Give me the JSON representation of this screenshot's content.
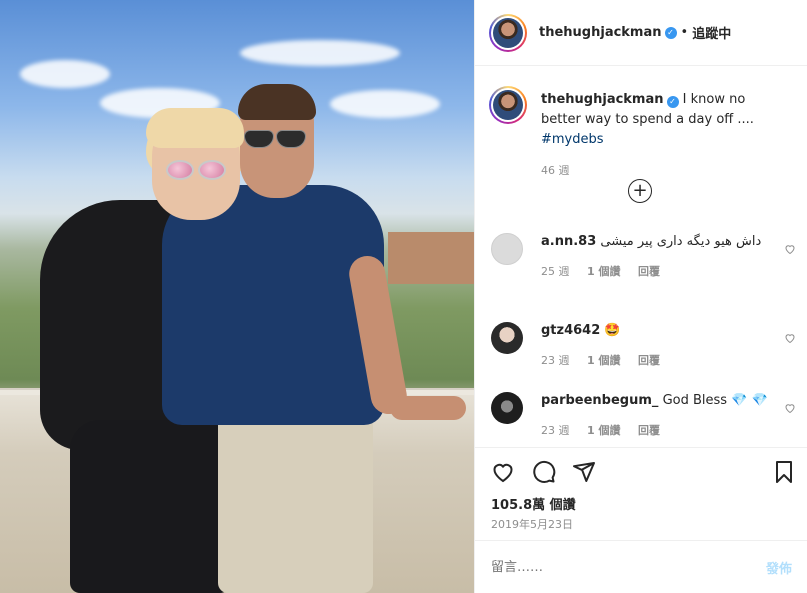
{
  "header": {
    "username": "thehughjackman",
    "verified": true,
    "separator": "•",
    "follow_label": "追蹤中"
  },
  "caption": {
    "username": "thehughjackman",
    "text": "I know no better way to spend a day off ....",
    "hashtag": "#mydebs",
    "time": "46 週"
  },
  "load_more_icon": "plus-circle-icon",
  "comments": [
    {
      "username": "a.nn.83",
      "text": "داش هیو دیگه داری پیر میشی",
      "time": "25 週",
      "likes": "1 個讚",
      "reply": "回覆"
    },
    {
      "username": "gtz4642",
      "text": "🤩",
      "time": "23 週",
      "likes": "1 個讚",
      "reply": "回覆"
    },
    {
      "username": "parbeenbegum_",
      "text": "God Bless 💎 💎",
      "time": "23 週",
      "likes": "1 個讚",
      "reply": "回覆"
    }
  ],
  "actions": {
    "like_icon": "heart-icon",
    "comment_icon": "comment-icon",
    "share_icon": "paper-plane-icon",
    "save_icon": "bookmark-icon"
  },
  "likes_count": "105.8萬 個讚",
  "post_date": "2019年5月23日",
  "comment_box": {
    "placeholder": "留言……",
    "post_label": "發佈"
  },
  "colors": {
    "link": "#00376b",
    "verified": "#3897f0",
    "muted": "#8e8e8e",
    "post_disabled": "#b2dffc"
  }
}
